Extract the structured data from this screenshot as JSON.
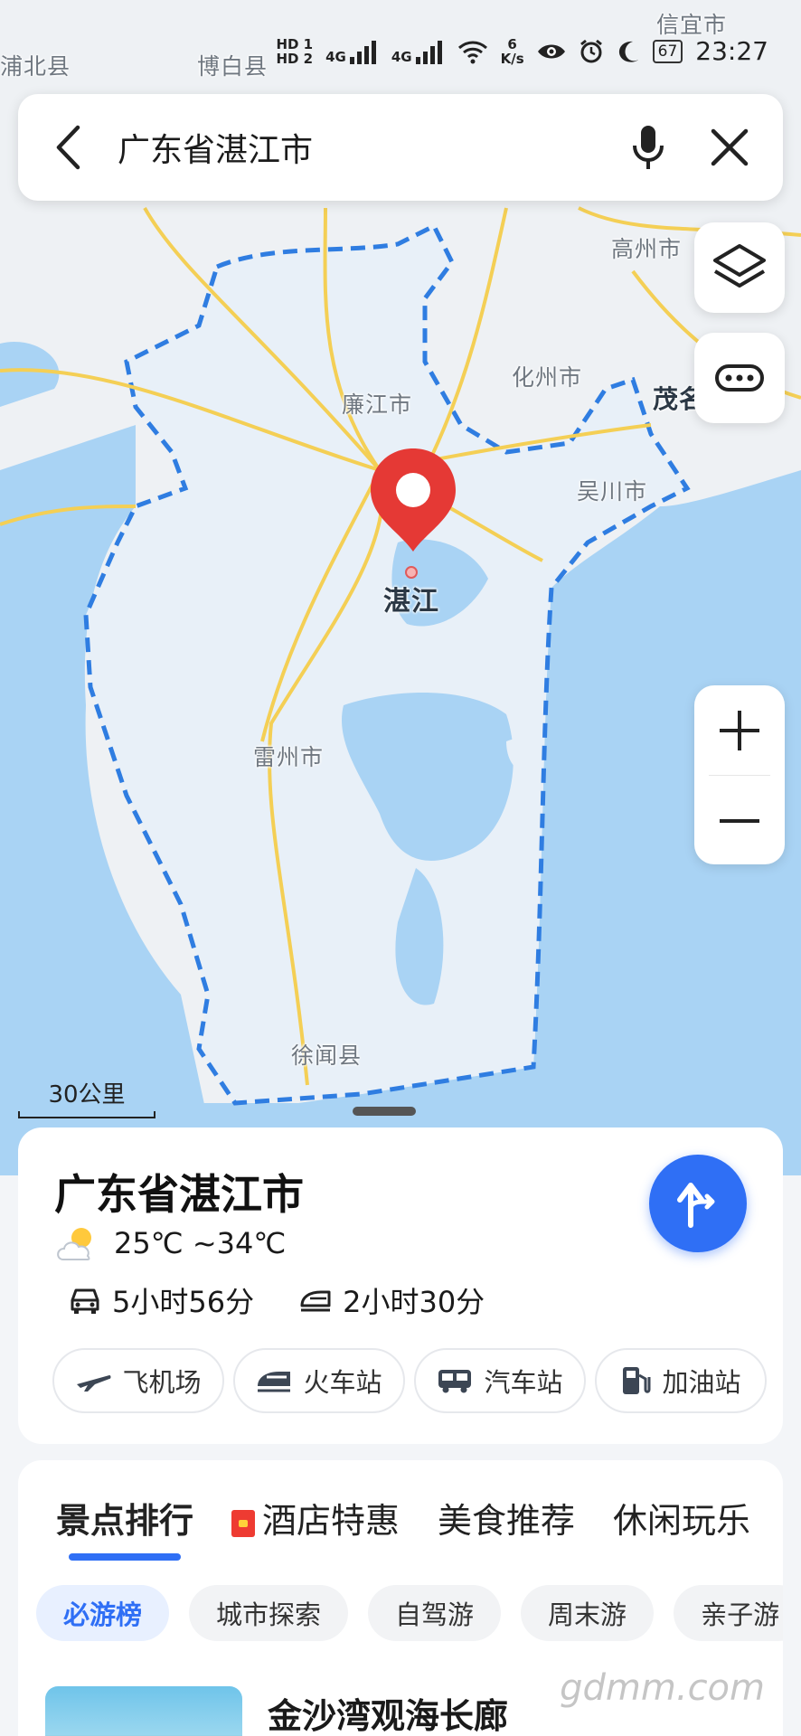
{
  "status_bar": {
    "hd1": "HD 1",
    "hd2": "HD 2",
    "net1": "4G",
    "net2": "4G",
    "speed_value": "6",
    "speed_unit": "K/s",
    "battery": "67",
    "time": "23:27"
  },
  "search": {
    "query": "广东省湛江市"
  },
  "map": {
    "places": {
      "puibei": "浦北县",
      "bobai": "博白县",
      "xinyi": "信宜市",
      "gaozhou": "高州市",
      "huazhou": "化州市",
      "maoming": "茂名",
      "lianjiang": "廉江市",
      "wuchuan": "吴川市",
      "zhanjiang": "湛江",
      "leizhou": "雷州市",
      "xuwen": "徐闻县"
    },
    "scale_label": "30公里",
    "colors": {
      "sea": "#a9d3f4",
      "land": "#eef1f4",
      "region_fill": "#e8f0f8",
      "boundary": "#2f7de1",
      "road": "#f4cf55",
      "pin": "#e53935"
    }
  },
  "info_card": {
    "title": "广东省湛江市",
    "weather": "25℃ ~34℃",
    "drive_time": "5小时56分",
    "train_time": "2小时30分",
    "chips": [
      {
        "label": "飞机场",
        "icon": "plane-icon"
      },
      {
        "label": "火车站",
        "icon": "train-icon"
      },
      {
        "label": "汽车站",
        "icon": "bus-icon"
      },
      {
        "label": "加油站",
        "icon": "gas-station-icon"
      }
    ]
  },
  "guide_card": {
    "tabs": [
      "景点排行",
      "酒店特惠",
      "美食推荐",
      "休闲玩乐"
    ],
    "active_tab": "景点排行",
    "filters": [
      "必游榜",
      "城市探索",
      "自驾游",
      "周末游",
      "亲子游"
    ],
    "active_filter": "必游榜",
    "first_spot": "金沙湾观海长廊"
  },
  "watermark": "gdmm.com"
}
